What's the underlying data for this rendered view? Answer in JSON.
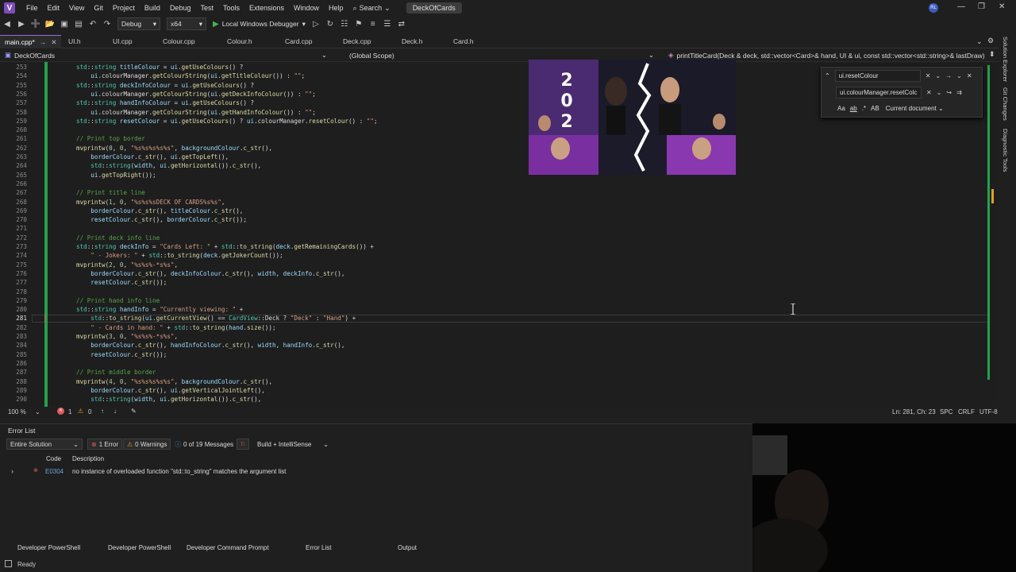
{
  "menu": {
    "items": [
      "File",
      "Edit",
      "View",
      "Git",
      "Project",
      "Build",
      "Debug",
      "Test",
      "Tools",
      "Extensions",
      "Window",
      "Help"
    ],
    "search_label": "Search",
    "solution_name": "DeckOfCards",
    "account_initials": "RL"
  },
  "toolbar": {
    "config": "Debug",
    "platform": "x64",
    "run_label": "Local Windows Debugger"
  },
  "tabs": {
    "active": "main.cpp*",
    "others": [
      "UI.h",
      "UI.cpp",
      "Colour.cpp",
      "Colour.h",
      "Card.cpp",
      "Deck.cpp",
      "Deck.h",
      "Card.h"
    ]
  },
  "navbar": {
    "project": "DeckOfCards",
    "scope": "(Global Scope)",
    "function": "printTitleCard(Deck & deck, std::vector<Card>& hand, UI & ui, const std::vector<std::string>& lastDraw)"
  },
  "editor": {
    "line_numbers": [
      "253",
      "254",
      "255",
      "256",
      "257",
      "258",
      "259",
      "260",
      "261",
      "262",
      "263",
      "264",
      "265",
      "266",
      "267",
      "268",
      "269",
      "270",
      "271",
      "272",
      "273",
      "274",
      "275",
      "276",
      "277",
      "278",
      "279",
      "280",
      "281",
      "282",
      "283",
      "284",
      "285",
      "286",
      "287",
      "288",
      "289",
      "290"
    ],
    "current_line": "281",
    "lines": [
      "std::string titleColour = ui.getUseColours() ?",
      "    ui.colourManager.getColourString(ui.getTitleColour()) : \"\";",
      "std::string deckInfoColour = ui.getUseColours() ?",
      "    ui.colourManager.getColourString(ui.getDeckInfoColour()) : \"\";",
      "std::string handInfoColour = ui.getUseColours() ?",
      "    ui.colourManager.getColourString(ui.getHandInfoColour()) : \"\";",
      "std::string resetColour = ui.getUseColours() ? ui.colourManager.resetColour() : \"\";",
      "",
      "// Print top border",
      "mvprintw(0, 0, \"%s%s%s%s%s\", backgroundColour.c_str(),",
      "    borderColour.c_str(), ui.getTopLeft(),",
      "    std::string(width, ui.getHorizontal()).c_str(),",
      "    ui.getTopRight());",
      "",
      "// Print title line",
      "mvprintw(1, 0, \"%s%s%sDECK OF CARDS%s%s\",",
      "    borderColour.c_str(), titleColour.c_str(),",
      "    resetColour.c_str(), borderColour.c_str());",
      "",
      "// Print deck info line",
      "std::string deckInfo = \"Cards Left: \" + std::to_string(deck.getRemainingCards()) +",
      "    \" - Jokers: \" + std::to_string(deck.getJokerCount());",
      "mvprintw(2, 0, \"%s%s%-*s%s\",",
      "    borderColour.c_str(), deckInfoColour.c_str(), width, deckInfo.c_str(),",
      "    resetColour.c_str());",
      "",
      "// Print hand info line",
      "std::string handInfo = \"Currently viewing: \" +",
      "    std::to_string(ui.getCurrentView() == CardView::Deck ? \"Deck\" : \"Hand\") +",
      "    \" - Cards in hand: \" + std::to_string(hand.size());",
      "mvprintw(3, 0, \"%s%s%-*s%s\",",
      "    borderColour.c_str(), handInfoColour.c_str(), width, handInfo.c_str(),",
      "    resetColour.c_str());",
      "",
      "// Print middle border",
      "mvprintw(4, 0, \"%s%s%s%s%s\", backgroundColour.c_str(),",
      "    borderColour.c_str(), ui.getVerticalJointLeft(),",
      "    std::string(width, ui.getHorizontal()).c_str(),"
    ]
  },
  "find": {
    "find_value": "ui.resetColour",
    "replace_value": "ui.colourManager.resetColc",
    "scope": "Current document",
    "opt_case": "Aa",
    "opt_word": "ab",
    "opt_regex": ".*",
    "opt_preserve": "AB"
  },
  "video": {
    "year_digits": [
      "2",
      "0",
      "2"
    ]
  },
  "side_panel": [
    "Solution Explorer",
    "Git Changes",
    "Diagnostic Tools"
  ],
  "editor_status": {
    "zoom": "100 %",
    "errors": "1",
    "warnings": "0",
    "position": "Ln: 281, Ch: 23",
    "spacing": "SPC",
    "line_ending": "CRLF",
    "encoding": "UTF-8"
  },
  "error_list": {
    "title": "Error List",
    "scope": "Entire Solution",
    "errors_filter": "1 Error",
    "warnings_filter": "0 Warnings",
    "messages_filter": "0 of 19 Messages",
    "build_filter": "Build + IntelliSense",
    "col_code": "Code",
    "col_description": "Description",
    "rows": [
      {
        "code": "E0304",
        "description": "no instance of overloaded function \"std::to_string\" matches the argument list"
      }
    ]
  },
  "bottom_tabs": [
    "Developer PowerShell",
    "Developer PowerShell",
    "Developer Command Prompt",
    "Error List",
    "Output"
  ],
  "status": {
    "text": "Ready"
  },
  "colors": {
    "accent": "#9b6ad6",
    "change_bar": "#25a04c",
    "error": "#e05a5a"
  }
}
